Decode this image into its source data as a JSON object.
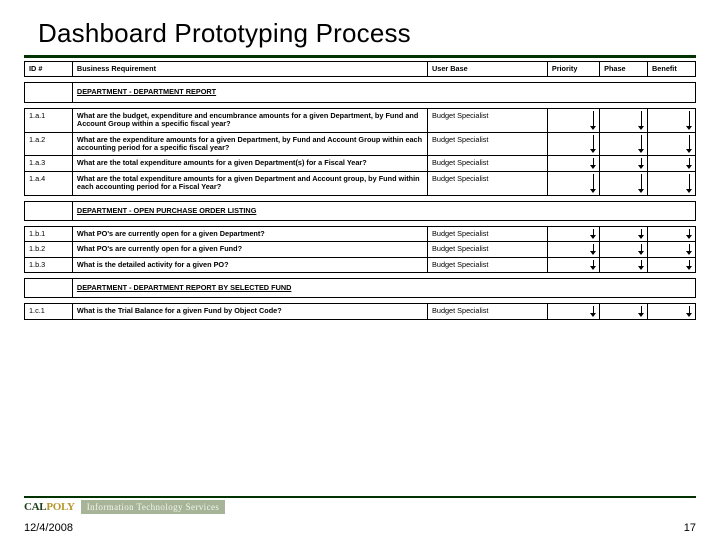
{
  "title": "Dashboard Prototyping Process",
  "columns": [
    "ID #",
    "Business Requirement",
    "User Base",
    "Priority",
    "Phase",
    "Benefit"
  ],
  "sections": [
    {
      "heading": "DEPARTMENT - DEPARTMENT REPORT",
      "rows": [
        {
          "id": "1.a.1",
          "req": "What are the budget, expenditure and encumbrance amounts for a given Department, by Fund and Account Group within a specific fiscal year?",
          "user": "Budget Specialist"
        },
        {
          "id": "1.a.2",
          "req": "What are the expenditure amounts for a given Department, by Fund and Account Group within each accounting period for a specific fiscal year?",
          "user": "Budget Specialist"
        },
        {
          "id": "1.a.3",
          "req": "What are the total expenditure amounts for a given Department(s) for a Fiscal Year?",
          "user": "Budget Specialist"
        },
        {
          "id": "1.a.4",
          "req": "What are the total expenditure amounts for a given Department and Account group, by Fund within each accounting period for a Fiscal Year?",
          "user": "Budget Specialist"
        }
      ]
    },
    {
      "heading": "DEPARTMENT - OPEN PURCHASE ORDER LISTING",
      "rows": [
        {
          "id": "1.b.1",
          "req": "What PO's are currently open for a given Department?",
          "user": "Budget Specialist"
        },
        {
          "id": "1.b.2",
          "req": "What PO's are currently open for a given Fund?",
          "user": "Budget Specialist"
        },
        {
          "id": "1.b.3",
          "req": "What is the detailed activity for a given PO?",
          "user": "Budget Specialist"
        }
      ]
    },
    {
      "heading": "DEPARTMENT - DEPARTMENT REPORT BY SELECTED FUND",
      "rows": [
        {
          "id": "1.c.1",
          "req": "What is the Trial Balance for a given Fund by Object Code?",
          "user": "Budget Specialist"
        }
      ]
    }
  ],
  "footer": {
    "logo1": "CAL POLY",
    "logo1_cal": "CAL",
    "logo1_poly": "POLY",
    "logo2": "Information Technology Services",
    "date": "12/4/2008",
    "page": "17"
  }
}
